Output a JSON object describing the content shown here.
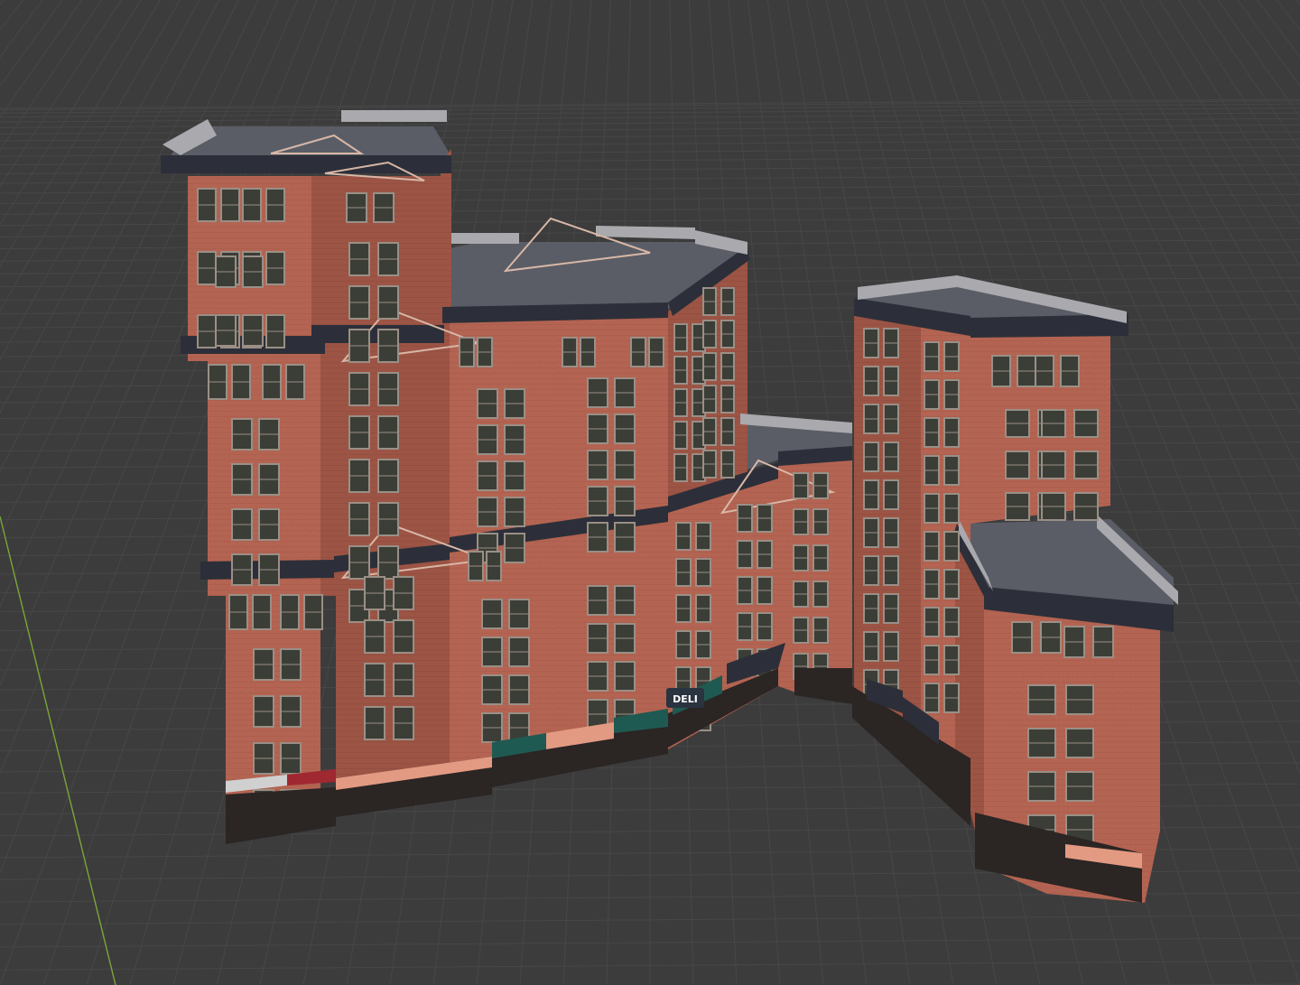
{
  "viewport": {
    "background_color": "#3c3c3c",
    "grid_line_color": "#474747",
    "y_axis_color": "#7aa63a"
  },
  "model": {
    "brick_color": "#b46452",
    "brick_dark_color": "#9c5444",
    "roof_color": "#5a5d66",
    "cornice_color": "#2c2f39",
    "parapet_color": "#a9a9ae",
    "window_color": "#3b3e36",
    "window_frame_color": "#9a8f86",
    "awning_green": "#1f5a52",
    "awning_salmon": "#e39a82",
    "deli_color": "#2a3340"
  },
  "storefront": {
    "deli_sign": "DELI"
  }
}
